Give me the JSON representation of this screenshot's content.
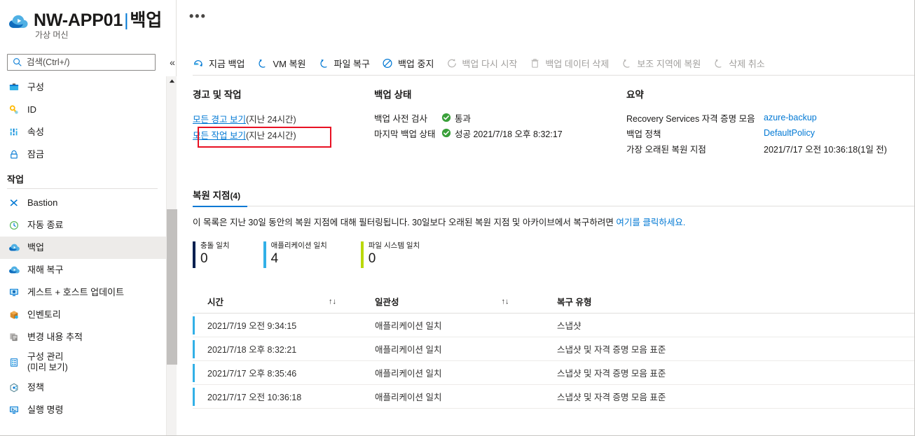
{
  "header": {
    "resource_name": "NW-APP01",
    "separator": "|",
    "blade_name": "백업",
    "subtitle": "가상 머신",
    "resource_icon": "azure-backup-cloud-icon",
    "ellipsis_label": "•••"
  },
  "search": {
    "placeholder": "검색(Ctrl+/)",
    "value": "",
    "collapse_label": "«"
  },
  "sidebar": {
    "items": [
      {
        "label": "구성",
        "icon": "configuration-icon",
        "selected": false
      },
      {
        "label": "ID",
        "icon": "identity-key-icon",
        "selected": false
      },
      {
        "label": "속성",
        "icon": "properties-icon",
        "selected": false
      },
      {
        "label": "잠금",
        "icon": "lock-icon",
        "selected": false
      }
    ],
    "section_label": "작업",
    "operation_items": [
      {
        "label": "Bastion",
        "icon": "bastion-icon",
        "selected": false
      },
      {
        "label": "자동 종료",
        "icon": "auto-shutdown-clock-icon",
        "selected": false
      },
      {
        "label": "백업",
        "icon": "backup-cloud-icon",
        "selected": true
      },
      {
        "label": "재해 복구",
        "icon": "disaster-recovery-cloud-icon",
        "selected": false
      },
      {
        "label": "게스트 + 호스트 업데이트",
        "icon": "guest-host-updates-icon",
        "selected": false
      },
      {
        "label": "인벤토리",
        "icon": "inventory-box-icon",
        "selected": false
      },
      {
        "label": "변경 내용 추적",
        "icon": "change-tracking-icon",
        "selected": false
      },
      {
        "label": "구성 관리",
        "sublabel": "(미리 보기)",
        "icon": "configuration-management-icon",
        "selected": false
      },
      {
        "label": "정책",
        "icon": "policy-icon",
        "selected": false
      },
      {
        "label": "실행 명령",
        "icon": "run-command-icon",
        "selected": false
      }
    ]
  },
  "command_bar": {
    "commands": [
      {
        "label": "지금 백업",
        "icon": "backup-now-icon",
        "disabled": false
      },
      {
        "label": "VM 복원",
        "icon": "restore-vm-icon",
        "disabled": false
      },
      {
        "label": "파일 복구",
        "icon": "file-recovery-icon",
        "disabled": false
      },
      {
        "label": "백업 중지",
        "icon": "stop-backup-icon",
        "disabled": false
      },
      {
        "label": "백업 다시 시작",
        "icon": "resume-backup-icon",
        "disabled": true
      },
      {
        "label": "백업 데이터 삭제",
        "icon": "delete-backup-data-trash-icon",
        "disabled": true
      },
      {
        "label": "보조 지역에 복원",
        "icon": "restore-secondary-region-icon",
        "disabled": true
      },
      {
        "label": "삭제 취소",
        "icon": "undelete-icon",
        "disabled": true
      }
    ]
  },
  "alerts_panel": {
    "title": "경고 및 작업",
    "view_all_alerts": "모든 경고 보기",
    "view_all_alerts_suffix": " (지난 24시간)",
    "view_all_jobs": "모든 작업 보기",
    "view_all_jobs_suffix": " (지난 24시간)",
    "highlight_color": "#e81123"
  },
  "status_panel": {
    "title": "백업 상태",
    "rows": [
      {
        "label": "백업 사전 검사",
        "icon": "success-check-icon",
        "value": "통과"
      },
      {
        "label": "마지막 백업 상태",
        "icon": "success-check-icon",
        "value": "성공 2021/7/18 오후 8:32:17"
      }
    ]
  },
  "summary_panel": {
    "title": "요약",
    "rows": [
      {
        "label": "Recovery Services 자격 증명 모음",
        "value": "azure-backup",
        "is_link": true
      },
      {
        "label": "백업 정책",
        "value": "DefaultPolicy",
        "is_link": true
      },
      {
        "label": "가장 오래된 복원 지점",
        "value": "2021/7/17 오전 10:36:18(1일 전)",
        "is_link": false
      }
    ]
  },
  "restore_points": {
    "tab_label": "복원 지점",
    "tab_count": "(4)",
    "description_prefix": "이 목록은 지난 30일 동안의 복원 지점에 대해 필터링됩니다. 30일보다 오래된 복원 지점 및 아카이브에서 복구하려면 ",
    "description_link": "여기를 클릭하세요.",
    "stats": [
      {
        "label": "충돌 일치",
        "value": "0",
        "color": "#002050"
      },
      {
        "label": "애플리케이션 일치",
        "value": "4",
        "color": "#32b0e7"
      },
      {
        "label": "파일 시스템 일치",
        "value": "0",
        "color": "#bad80a"
      }
    ],
    "columns": [
      {
        "key": "time",
        "label": "시간",
        "sortable": true,
        "sort_icon": "sort-updown-icon"
      },
      {
        "key": "consistency",
        "label": "일관성",
        "sortable": true,
        "sort_icon": "sort-updown-icon"
      },
      {
        "key": "recovery_type",
        "label": "복구 유형",
        "sortable": false
      }
    ],
    "rows": [
      {
        "time": "2021/7/19 오전 9:34:15",
        "consistency": "애플리케이션 일치",
        "recovery_type": "스냅샷"
      },
      {
        "time": "2021/7/18 오후 8:32:21",
        "consistency": "애플리케이션 일치",
        "recovery_type": "스냅샷 및 자격 증명 모음 표준"
      },
      {
        "time": "2021/7/17 오후 8:35:46",
        "consistency": "애플리케이션 일치",
        "recovery_type": "스냅샷 및 자격 증명 모음 표준"
      },
      {
        "time": "2021/7/17 오전 10:36:18",
        "consistency": "애플리케이션 일치",
        "recovery_type": "스냅샷 및 자격 증명 모음 표준"
      }
    ],
    "row_accent_color": "#32b0e7"
  },
  "theme": {
    "accent": "#0078d4",
    "success": "#107c10",
    "disabled_text": "#a19f9d"
  }
}
